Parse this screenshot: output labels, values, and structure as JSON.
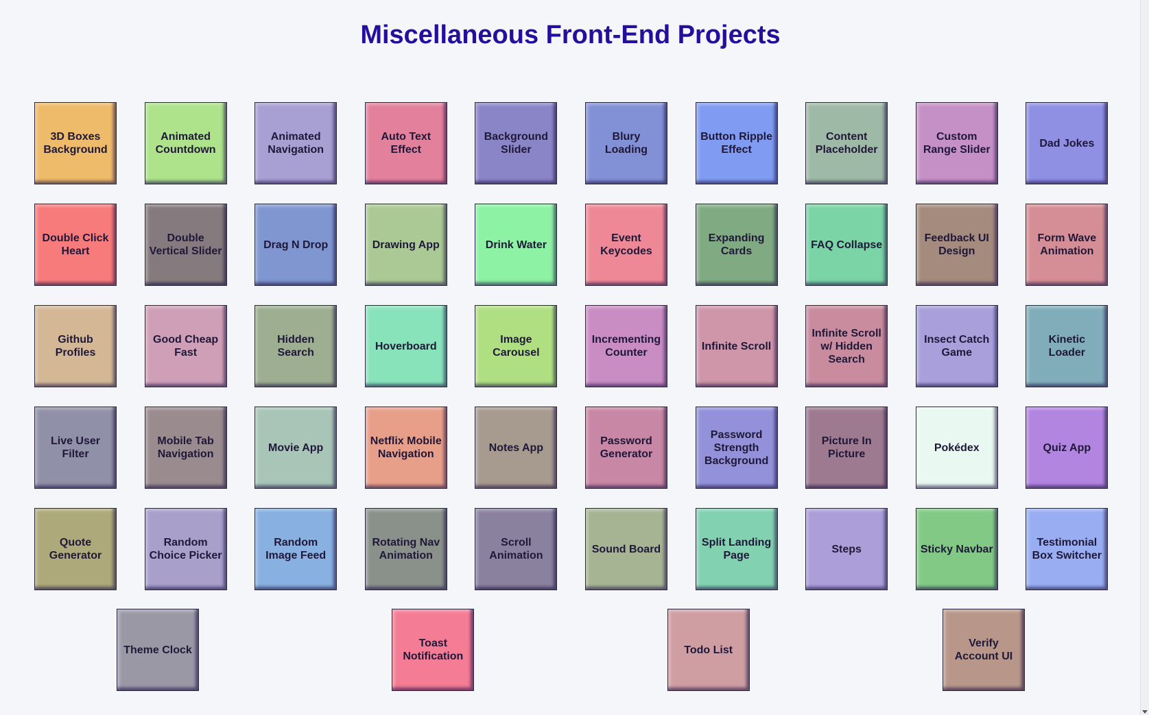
{
  "page": {
    "title": "Miscellaneous Front-End Projects"
  },
  "projects": [
    {
      "label": "3D Boxes Background",
      "color": "#eebb6a"
    },
    {
      "label": "Animated Countdown",
      "color": "#aee38c"
    },
    {
      "label": "Animated Navigation",
      "color": "#a89fd3"
    },
    {
      "label": "Auto Text Effect",
      "color": "#e3809b"
    },
    {
      "label": "Background Slider",
      "color": "#8a85c7"
    },
    {
      "label": "Blury Loading",
      "color": "#8290d6"
    },
    {
      "label": "Button Ripple Effect",
      "color": "#7f9cf2"
    },
    {
      "label": "Content Placeholder",
      "color": "#9eb9a5"
    },
    {
      "label": "Custom Range Slider",
      "color": "#c590c5"
    },
    {
      "label": "Dad Jokes",
      "color": "#8f8fe3"
    },
    {
      "label": "Double Click Heart",
      "color": "#f77b7b"
    },
    {
      "label": "Double Vertical Slider",
      "color": "#857b7e"
    },
    {
      "label": "Drag N Drop",
      "color": "#8096d0"
    },
    {
      "label": "Drawing App",
      "color": "#aac994"
    },
    {
      "label": "Drink Water",
      "color": "#8df2a4"
    },
    {
      "label": "Event Keycodes",
      "color": "#ef8896"
    },
    {
      "label": "Expanding Cards",
      "color": "#80ab82"
    },
    {
      "label": "FAQ Collapse",
      "color": "#7bd4a5"
    },
    {
      "label": "Feedback UI Design",
      "color": "#a58a7e"
    },
    {
      "label": "Form Wave Animation",
      "color": "#d58e95"
    },
    {
      "label": "Github Profiles",
      "color": "#d4b896"
    },
    {
      "label": "Good Cheap Fast",
      "color": "#cf9eb7"
    },
    {
      "label": "Hidden Search",
      "color": "#9dae91"
    },
    {
      "label": "Hoverboard",
      "color": "#88e3bb"
    },
    {
      "label": "Image Carousel",
      "color": "#b0df82"
    },
    {
      "label": "Incrementing Counter",
      "color": "#c98cc3"
    },
    {
      "label": "Infinite Scroll",
      "color": "#cf95a8"
    },
    {
      "label": "Infinite Scroll w/ Hidden Search",
      "color": "#c98c9e"
    },
    {
      "label": "Insect Catch Game",
      "color": "#a99fda"
    },
    {
      "label": "Kinetic Loader",
      "color": "#81adbb"
    },
    {
      "label": "Live User Filter",
      "color": "#9090a8"
    },
    {
      "label": "Mobile Tab Navigation",
      "color": "#9a8b8e"
    },
    {
      "label": "Movie App",
      "color": "#a8c5b7"
    },
    {
      "label": "Netflix Mobile Navigation",
      "color": "#e79f89"
    },
    {
      "label": "Notes App",
      "color": "#a79a8f"
    },
    {
      "label": "Password Generator",
      "color": "#c887a4"
    },
    {
      "label": "Password Strength Background",
      "color": "#9391d9"
    },
    {
      "label": "Picture In Picture",
      "color": "#9d7a90"
    },
    {
      "label": "Pokédex",
      "color": "#e9f8f1"
    },
    {
      "label": "Quiz App",
      "color": "#b285e0"
    },
    {
      "label": "Quote Generator",
      "color": "#ada97a"
    },
    {
      "label": "Random Choice Picker",
      "color": "#a89fcb"
    },
    {
      "label": "Random Image Feed",
      "color": "#88b0e0"
    },
    {
      "label": "Rotating Nav Animation",
      "color": "#8a918b"
    },
    {
      "label": "Scroll Animation",
      "color": "#8a819e"
    },
    {
      "label": "Sound Board",
      "color": "#a7b494"
    },
    {
      "label": "Split Landing Page",
      "color": "#82d1b1"
    },
    {
      "label": "Steps",
      "color": "#ac9ed8"
    },
    {
      "label": "Sticky Navbar",
      "color": "#82c986"
    },
    {
      "label": "Testimonial Box Switcher",
      "color": "#99aef2"
    }
  ],
  "last_row": [
    {
      "label": "Theme Clock",
      "color": "#9b98a6"
    },
    {
      "label": "Toast Notification",
      "color": "#f47c95"
    },
    {
      "label": "Todo List",
      "color": "#cf9ea3"
    },
    {
      "label": "Verify Account UI",
      "color": "#b8978a"
    }
  ]
}
